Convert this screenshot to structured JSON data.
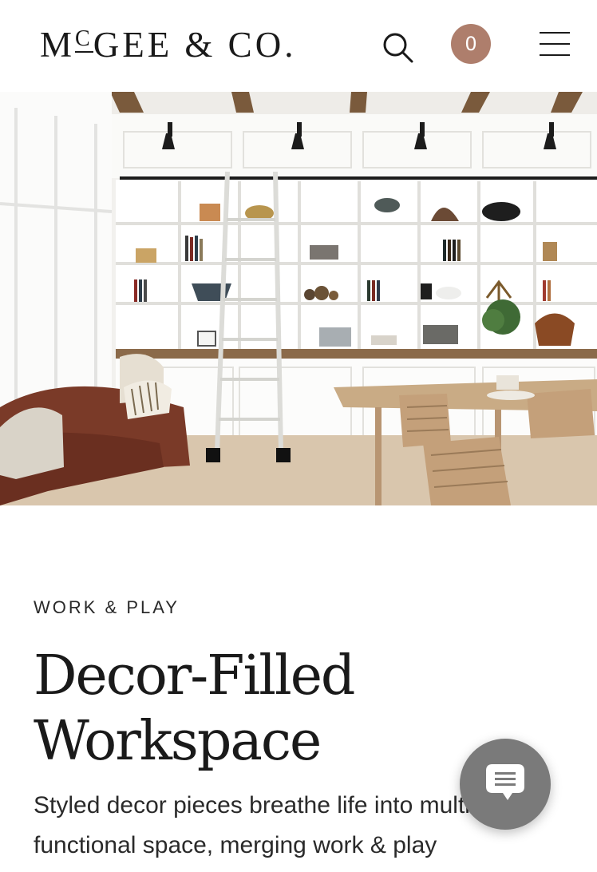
{
  "header": {
    "logo_text": "McGEE & CO.",
    "cart_count": "0",
    "cart_color": "#ae7e6c"
  },
  "icons": {
    "search": "search-icon",
    "menu": "hamburger-menu-icon",
    "chat": "chat-bubble-icon"
  },
  "hero": {
    "image_subject": "room-photo"
  },
  "article": {
    "eyebrow": "WORK & PLAY",
    "title": "Decor-Filled Workspace",
    "description": "Styled decor pieces breathe life into multi-functional space, merging work & play"
  }
}
